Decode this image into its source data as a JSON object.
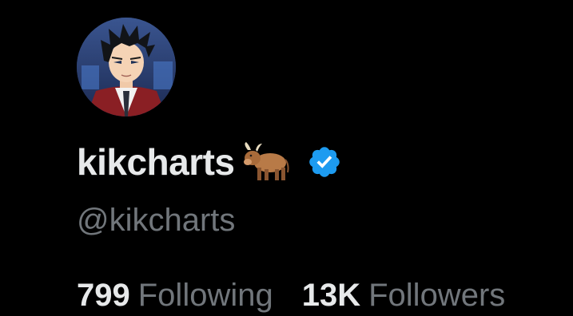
{
  "profile": {
    "display_name": "kikcharts",
    "name_emoji": "ox-emoji",
    "verified_badge": "verified-badge-icon",
    "handle": "@kikcharts",
    "avatar": "anime-character-avatar"
  },
  "stats": {
    "following_count": "799",
    "following_label": "Following",
    "followers_count": "13K",
    "followers_label": "Followers"
  },
  "colors": {
    "background": "#000000",
    "primary_text": "#e7e9ea",
    "secondary_text": "#71767b",
    "verified_blue": "#1d9bf0"
  }
}
